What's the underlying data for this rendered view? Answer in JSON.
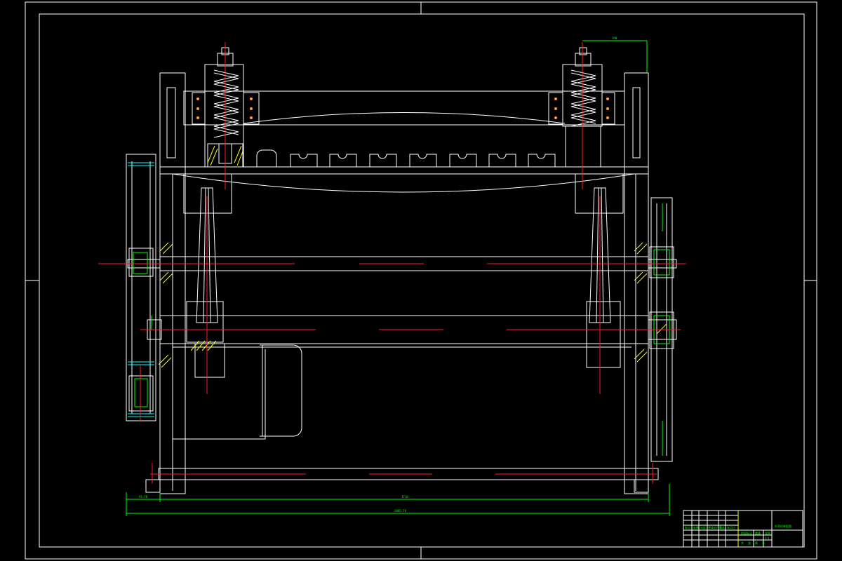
{
  "drawing": {
    "colors": {
      "background": "#000000",
      "outline": "#ffffff",
      "centerline": "#ff2020",
      "dimension": "#00ff00",
      "hatch": "#ffff00",
      "bolt": "#ffa030"
    },
    "dimensions": {
      "top_offset": "190",
      "left_offset": "95.78",
      "overall_inner": "1710",
      "overall_total": "2005.78"
    },
    "title_block": {
      "title": "折弯机装配图",
      "revision_marks": [
        "标记",
        "处数",
        "分区",
        "更改文件号",
        "签名",
        "年月日"
      ],
      "scale_label": "比例",
      "weight_label": "重量",
      "stage_label": "阶段标记",
      "ratio": "1:1",
      "sheet_labels": [
        "共",
        "张",
        "第",
        "张"
      ]
    }
  }
}
